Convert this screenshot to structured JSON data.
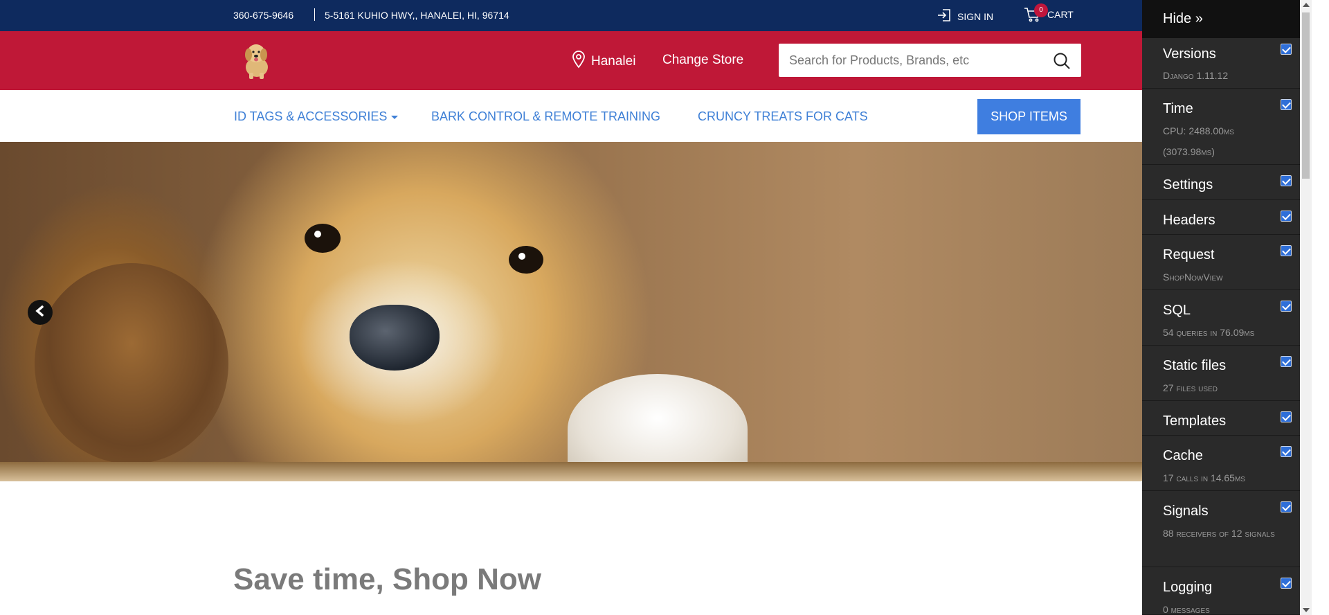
{
  "topbar": {
    "phone": "360-675-9646",
    "address": "5-5161 KUHIO HWY,, HANALEI, HI, 96714",
    "sign_in": "SIGN IN",
    "cart_label": "CART",
    "cart_count": "0"
  },
  "header": {
    "store_name": "Hanalei",
    "change_store": "Change Store",
    "search_placeholder": "Search for Products, Brands, etc"
  },
  "nav": {
    "items": [
      {
        "label": "ID TAGS & ACCESSORIES"
      },
      {
        "label": "BARK CONTROL & REMOTE TRAINING"
      },
      {
        "label": "CRUNCY TREATS FOR CATS"
      }
    ],
    "shop_items": "SHOP ITEMS"
  },
  "main": {
    "headline": "Save time, Shop Now"
  },
  "debug_toolbar": {
    "hide": "Hide »",
    "panels": [
      {
        "title": "Versions",
        "sub": "Django 1.11.12",
        "checked": true
      },
      {
        "title": "Time",
        "sub": "CPU: 2488.00ms (3073.98ms)",
        "checked": true
      },
      {
        "title": "Settings",
        "sub": "",
        "checked": true
      },
      {
        "title": "Headers",
        "sub": "",
        "checked": true
      },
      {
        "title": "Request",
        "sub": "ShopNowView",
        "checked": true
      },
      {
        "title": "SQL",
        "sub": "54 queries in 76.09ms",
        "checked": true
      },
      {
        "title": "Static files",
        "sub": "27 files used",
        "checked": true
      },
      {
        "title": "Templates",
        "sub": "",
        "checked": true
      },
      {
        "title": "Cache",
        "sub": "17 calls in 14.65ms",
        "checked": true
      },
      {
        "title": "Signals",
        "sub": "88 receivers of 12 signals",
        "checked": true
      },
      {
        "title": "Logging",
        "sub": "0 messages",
        "checked": true
      }
    ]
  },
  "colors": {
    "topbar": "#0e2a5e",
    "header": "#bf1837",
    "nav_link": "#3f80d6",
    "button": "#3f7ee0"
  }
}
